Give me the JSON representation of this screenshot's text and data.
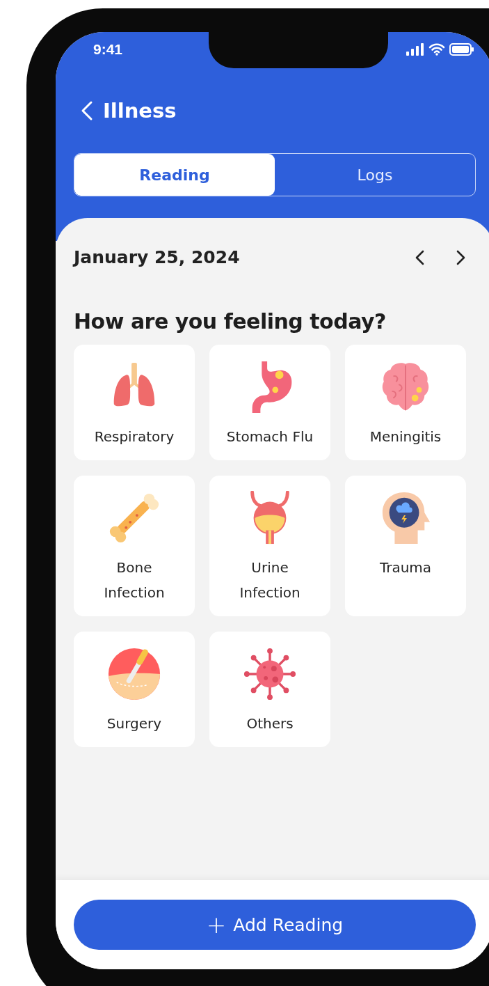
{
  "status_bar": {
    "time": "9:41"
  },
  "header": {
    "title": "Illness"
  },
  "tabs": [
    {
      "label": "Reading",
      "selected": true
    },
    {
      "label": "Logs",
      "selected": false
    }
  ],
  "date": "January 25, 2024",
  "question": "How are you feeling today?",
  "illnesses": [
    {
      "label": "Respiratory",
      "kind": "lungs"
    },
    {
      "label": "Stomach Flu",
      "kind": "stomach"
    },
    {
      "label": "Meningitis",
      "kind": "brain"
    },
    {
      "label": "Bone Infection",
      "kind": "bone"
    },
    {
      "label": "Urine Infection",
      "kind": "bladder"
    },
    {
      "label": "Trauma",
      "kind": "head"
    },
    {
      "label": "Surgery",
      "kind": "scalpel"
    },
    {
      "label": "Others",
      "kind": "virus"
    }
  ],
  "add_button": {
    "icon": "+",
    "label": "Add Reading"
  }
}
